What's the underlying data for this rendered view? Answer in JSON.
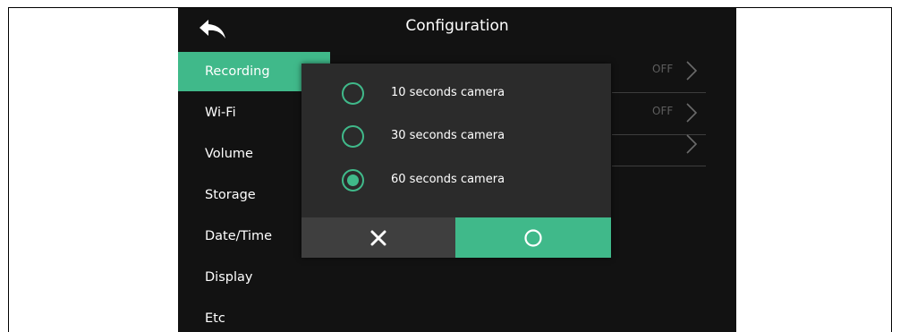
{
  "header": {
    "title": "Configuration",
    "back_icon": "back-arrow-icon"
  },
  "sidebar": {
    "items": [
      {
        "label": "Recording",
        "active": true
      },
      {
        "label": "Wi-Fi",
        "active": false
      },
      {
        "label": "Volume",
        "active": false
      },
      {
        "label": "Storage",
        "active": false
      },
      {
        "label": "Date/Time",
        "active": false
      },
      {
        "label": "Display",
        "active": false
      },
      {
        "label": "Etc",
        "active": false
      }
    ]
  },
  "settings": {
    "rows": [
      {
        "value": "OFF"
      },
      {
        "value": "OFF"
      },
      {
        "value": ""
      }
    ]
  },
  "dialog": {
    "options": [
      {
        "label": "10 seconds camera",
        "selected": false
      },
      {
        "label": "30 seconds camera",
        "selected": false
      },
      {
        "label": "60 seconds camera",
        "selected": true
      }
    ],
    "cancel_icon": "close-icon",
    "confirm_icon": "circle-confirm-icon"
  },
  "colors": {
    "accent": "#40b98a",
    "background": "#121212",
    "dialog": "#2b2b2b",
    "cancel_button": "#3f3f3f"
  }
}
